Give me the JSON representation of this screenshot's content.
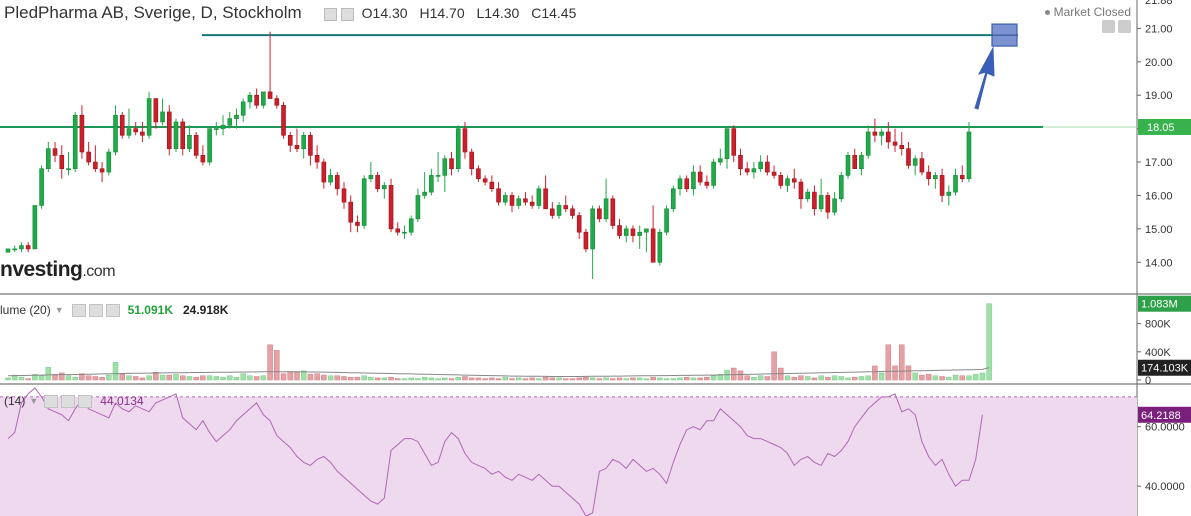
{
  "header": {
    "symbol": "PledPharma AB, Sverige, D, Stockholm",
    "open": "O14.30",
    "high": "H14.70",
    "low": "L14.30",
    "close": "C14.45",
    "market_status": "Market Closed"
  },
  "watermark": {
    "brand": "nvesting",
    "domain": ".com"
  },
  "volume_panel": {
    "label": "lume (20)",
    "value1": "51.091K",
    "value2": "24.918K"
  },
  "rsi_panel": {
    "label": "(14)",
    "value": "44.0134"
  },
  "colors": {
    "up": "#21a94a",
    "down": "#cc1f2b",
    "up_vol": "#9ee0a8",
    "down_vol": "#e5a1a6",
    "level_line": "#1d9656",
    "resistance_line": "#16777a",
    "arrow": "#3b5fb8",
    "rsi_fill": "#efd9ef",
    "rsi_line": "#b067b6",
    "rsi_badge": "#7b1f7c"
  },
  "chart_data": [
    {
      "type": "candlestick",
      "y_ticks": [
        "21.00",
        "20.00",
        "19.00",
        "18.00",
        "17.00",
        "16.00",
        "15.00",
        "14.00"
      ],
      "ylim": [
        13.05,
        21.85
      ],
      "top_partial_label": "21.88",
      "horizontal_lines": [
        {
          "value": 20.8,
          "name": "resistance"
        },
        {
          "value": 18.05,
          "name": "level",
          "label": "18.05"
        }
      ],
      "ohlc": [
        [
          14.3,
          14.4,
          14.3,
          14.4
        ],
        [
          14.4,
          14.5,
          14.3,
          14.4
        ],
        [
          14.4,
          14.6,
          14.3,
          14.5
        ],
        [
          14.5,
          14.6,
          14.3,
          14.4
        ],
        [
          14.4,
          15.7,
          14.4,
          15.7
        ],
        [
          15.7,
          16.9,
          15.6,
          16.8
        ],
        [
          16.8,
          17.6,
          16.7,
          17.4
        ],
        [
          17.4,
          17.6,
          17.0,
          17.2
        ],
        [
          17.2,
          17.5,
          16.5,
          16.8
        ],
        [
          16.8,
          17.3,
          16.6,
          16.8
        ],
        [
          16.8,
          18.5,
          16.7,
          18.4
        ],
        [
          18.4,
          18.7,
          17.1,
          17.3
        ],
        [
          17.3,
          17.6,
          16.9,
          17.0
        ],
        [
          17.0,
          17.5,
          16.7,
          16.8
        ],
        [
          16.8,
          17.0,
          16.4,
          16.7
        ],
        [
          16.7,
          17.4,
          16.6,
          17.3
        ],
        [
          17.3,
          18.7,
          17.2,
          18.4
        ],
        [
          18.4,
          18.5,
          17.7,
          17.8
        ],
        [
          17.8,
          18.6,
          17.7,
          18.0
        ],
        [
          18.0,
          18.2,
          17.8,
          17.9
        ],
        [
          17.9,
          18.2,
          17.6,
          17.8
        ],
        [
          17.8,
          19.1,
          17.7,
          18.9
        ],
        [
          18.9,
          18.9,
          18.0,
          18.2
        ],
        [
          18.2,
          18.9,
          18.1,
          18.5
        ],
        [
          18.5,
          18.7,
          17.2,
          17.4
        ],
        [
          17.4,
          18.3,
          17.3,
          18.2
        ],
        [
          18.2,
          18.3,
          17.2,
          17.4
        ],
        [
          17.4,
          18.1,
          17.3,
          17.8
        ],
        [
          17.8,
          17.9,
          17.1,
          17.2
        ],
        [
          17.2,
          17.5,
          16.9,
          17.0
        ],
        [
          17.0,
          18.0,
          16.9,
          18.0
        ],
        [
          18.0,
          18.2,
          17.8,
          18.0
        ],
        [
          18.0,
          18.4,
          17.8,
          18.1
        ],
        [
          18.1,
          18.5,
          18.0,
          18.3
        ],
        [
          18.3,
          18.6,
          18.0,
          18.4
        ],
        [
          18.4,
          18.9,
          18.2,
          18.8
        ],
        [
          18.8,
          19.1,
          18.6,
          19.0
        ],
        [
          19.0,
          19.2,
          18.6,
          18.7
        ],
        [
          18.7,
          19.1,
          18.6,
          19.1
        ],
        [
          19.1,
          20.9,
          18.9,
          18.9
        ],
        [
          18.9,
          19.0,
          18.6,
          18.7
        ],
        [
          18.7,
          18.8,
          17.7,
          17.8
        ],
        [
          17.8,
          17.9,
          17.3,
          17.5
        ],
        [
          17.5,
          18.0,
          17.3,
          17.4
        ],
        [
          17.4,
          17.9,
          17.1,
          17.8
        ],
        [
          17.8,
          17.9,
          16.9,
          17.2
        ],
        [
          17.2,
          17.5,
          16.8,
          17.0
        ],
        [
          17.0,
          17.1,
          16.2,
          16.4
        ],
        [
          16.4,
          16.8,
          16.3,
          16.6
        ],
        [
          16.6,
          16.7,
          16.0,
          16.2
        ],
        [
          16.2,
          16.4,
          15.6,
          15.8
        ],
        [
          15.8,
          16.0,
          14.9,
          15.2
        ],
        [
          15.2,
          15.4,
          14.9,
          15.1
        ],
        [
          15.1,
          16.6,
          15.0,
          16.5
        ],
        [
          16.5,
          17.0,
          16.4,
          16.6
        ],
        [
          16.6,
          16.7,
          16.1,
          16.2
        ],
        [
          16.2,
          16.4,
          15.9,
          16.3
        ],
        [
          16.3,
          16.5,
          14.9,
          15.0
        ],
        [
          15.0,
          15.2,
          14.8,
          14.9
        ],
        [
          14.9,
          15.1,
          14.7,
          14.9
        ],
        [
          14.9,
          15.4,
          14.8,
          15.3
        ],
        [
          15.3,
          16.2,
          15.2,
          16.0
        ],
        [
          16.0,
          16.7,
          15.9,
          16.1
        ],
        [
          16.1,
          16.8,
          16.0,
          16.6
        ],
        [
          16.6,
          17.3,
          16.4,
          16.6
        ],
        [
          16.6,
          17.2,
          16.1,
          17.1
        ],
        [
          17.1,
          17.3,
          16.6,
          16.8
        ],
        [
          16.8,
          18.1,
          16.7,
          18.0
        ],
        [
          18.0,
          18.2,
          17.1,
          17.3
        ],
        [
          17.3,
          17.4,
          16.6,
          16.8
        ],
        [
          16.8,
          16.9,
          16.4,
          16.5
        ],
        [
          16.5,
          16.6,
          16.3,
          16.4
        ],
        [
          16.4,
          16.6,
          16.1,
          16.2
        ],
        [
          16.2,
          16.4,
          15.7,
          15.8
        ],
        [
          15.8,
          16.1,
          15.7,
          16.0
        ],
        [
          16.0,
          16.1,
          15.5,
          15.7
        ],
        [
          15.7,
          16.0,
          15.6,
          15.9
        ],
        [
          15.9,
          16.1,
          15.7,
          15.8
        ],
        [
          15.8,
          16.0,
          15.6,
          15.7
        ],
        [
          15.7,
          16.3,
          15.6,
          16.2
        ],
        [
          16.2,
          16.6,
          15.7,
          15.6
        ],
        [
          15.6,
          15.8,
          15.3,
          15.4
        ],
        [
          15.4,
          15.8,
          15.3,
          15.7
        ],
        [
          15.7,
          16.0,
          15.5,
          15.6
        ],
        [
          15.6,
          15.7,
          15.3,
          15.4
        ],
        [
          15.4,
          15.5,
          14.7,
          14.9
        ],
        [
          14.9,
          15.0,
          14.3,
          14.4
        ],
        [
          14.4,
          15.7,
          13.5,
          15.6
        ],
        [
          15.6,
          15.7,
          15.2,
          15.3
        ],
        [
          15.3,
          16.5,
          15.2,
          15.9
        ],
        [
          15.9,
          16.0,
          15.0,
          15.1
        ],
        [
          15.1,
          15.3,
          14.7,
          14.8
        ],
        [
          14.8,
          15.1,
          14.6,
          15.0
        ],
        [
          15.0,
          15.1,
          14.6,
          14.8
        ],
        [
          14.8,
          15.1,
          14.4,
          14.9
        ],
        [
          14.9,
          15.0,
          14.3,
          15.0
        ],
        [
          15.0,
          15.7,
          14.0,
          14.0
        ],
        [
          14.0,
          15.0,
          13.9,
          14.9
        ],
        [
          14.9,
          15.7,
          14.8,
          15.6
        ],
        [
          15.6,
          16.3,
          15.5,
          16.2
        ],
        [
          16.2,
          16.6,
          16.0,
          16.5
        ],
        [
          16.5,
          16.6,
          16.1,
          16.2
        ],
        [
          16.2,
          16.9,
          16.0,
          16.7
        ],
        [
          16.7,
          16.9,
          16.3,
          16.4
        ],
        [
          16.4,
          16.6,
          16.2,
          16.3
        ],
        [
          16.3,
          17.1,
          16.2,
          17.0
        ],
        [
          17.0,
          17.4,
          16.9,
          17.1
        ],
        [
          17.1,
          18.0,
          16.8,
          18.0
        ],
        [
          18.0,
          18.1,
          17.0,
          17.2
        ],
        [
          17.2,
          17.4,
          16.6,
          16.8
        ],
        [
          16.8,
          17.0,
          16.6,
          16.7
        ],
        [
          16.7,
          17.0,
          16.5,
          16.8
        ],
        [
          16.8,
          17.2,
          16.7,
          17.0
        ],
        [
          17.0,
          17.2,
          16.6,
          16.7
        ],
        [
          16.7,
          16.9,
          16.5,
          16.6
        ],
        [
          16.6,
          16.7,
          16.2,
          16.3
        ],
        [
          16.3,
          16.6,
          16.1,
          16.5
        ],
        [
          16.5,
          16.8,
          16.2,
          16.4
        ],
        [
          16.4,
          16.5,
          15.6,
          15.9
        ],
        [
          15.9,
          16.2,
          15.8,
          16.1
        ],
        [
          16.1,
          16.3,
          15.4,
          15.6
        ],
        [
          15.6,
          16.5,
          15.5,
          16.0
        ],
        [
          16.0,
          16.1,
          15.3,
          15.5
        ],
        [
          15.5,
          16.1,
          15.4,
          15.9
        ],
        [
          15.9,
          16.7,
          15.8,
          16.6
        ],
        [
          16.6,
          17.3,
          16.5,
          17.2
        ],
        [
          17.2,
          17.4,
          16.9,
          16.8
        ],
        [
          16.8,
          17.3,
          16.6,
          17.2
        ],
        [
          17.2,
          18.1,
          17.1,
          17.9
        ],
        [
          17.9,
          18.3,
          17.6,
          17.8
        ],
        [
          17.8,
          18.0,
          17.5,
          17.9
        ],
        [
          17.9,
          18.2,
          17.4,
          17.6
        ],
        [
          17.6,
          18.0,
          17.3,
          17.5
        ],
        [
          17.5,
          17.9,
          17.2,
          17.4
        ],
        [
          17.4,
          17.6,
          16.8,
          16.9
        ],
        [
          16.9,
          17.2,
          16.6,
          17.1
        ],
        [
          17.1,
          17.3,
          16.6,
          16.7
        ],
        [
          16.7,
          16.9,
          16.3,
          16.5
        ],
        [
          16.5,
          16.7,
          16.2,
          16.6
        ],
        [
          16.6,
          16.8,
          15.8,
          16.0
        ],
        [
          16.0,
          16.3,
          15.7,
          16.1
        ],
        [
          16.1,
          16.8,
          16.0,
          16.6
        ],
        [
          16.6,
          16.9,
          16.4,
          16.5
        ],
        [
          16.5,
          18.2,
          16.4,
          17.9
        ]
      ]
    },
    {
      "type": "bar",
      "name": "volume",
      "y_ticks": [
        "800K",
        "400K",
        "0"
      ],
      "ylim": [
        0,
        1150
      ],
      "units": "K",
      "current_label": "1.083M",
      "ma_label": "174.103K",
      "values": [
        30,
        70,
        40,
        20,
        80,
        60,
        180,
        80,
        100,
        60,
        40,
        90,
        60,
        50,
        40,
        70,
        250,
        80,
        60,
        50,
        30,
        60,
        110,
        70,
        70,
        80,
        60,
        50,
        40,
        60,
        60,
        50,
        40,
        60,
        40,
        90,
        60,
        50,
        60,
        500,
        420,
        90,
        120,
        110,
        130,
        80,
        90,
        70,
        60,
        60,
        50,
        40,
        40,
        60,
        40,
        30,
        30,
        40,
        20,
        20,
        30,
        20,
        40,
        30,
        20,
        30,
        20,
        40,
        50,
        30,
        30,
        20,
        30,
        20,
        40,
        20,
        30,
        20,
        30,
        20,
        40,
        30,
        30,
        20,
        20,
        30,
        40,
        30,
        20,
        30,
        20,
        30,
        20,
        30,
        30,
        20,
        40,
        30,
        20,
        20,
        30,
        40,
        30,
        30,
        40,
        60,
        80,
        140,
        170,
        130,
        60,
        40,
        60,
        50,
        400,
        170,
        60,
        40,
        60,
        50,
        30,
        60,
        40,
        60,
        50,
        30,
        40,
        50,
        60,
        200,
        100,
        500,
        200,
        500,
        200,
        100,
        70,
        80,
        60,
        50,
        40,
        70,
        60,
        60,
        80,
        100,
        1083
      ],
      "ma": [
        60,
        62,
        64,
        66,
        68,
        70,
        72,
        74,
        76,
        77,
        78,
        80,
        82,
        84,
        86,
        88,
        90,
        92,
        94,
        95,
        96,
        98,
        100,
        101,
        102,
        103,
        104,
        105,
        106,
        107,
        108,
        109,
        110,
        111,
        112,
        113,
        114,
        115,
        116,
        117,
        118,
        118,
        117,
        116,
        115,
        114,
        113,
        112,
        110,
        108,
        106,
        104,
        102,
        100,
        98,
        96,
        94,
        92,
        90,
        88,
        86,
        84,
        82,
        80,
        78,
        76,
        74,
        72,
        70,
        68,
        66,
        64,
        62,
        60,
        58,
        56,
        55,
        54,
        53,
        52,
        51,
        50,
        50,
        50,
        50,
        50,
        51,
        52,
        53,
        54,
        55,
        56,
        57,
        58,
        59,
        60,
        61,
        62,
        63,
        64,
        65,
        66,
        67,
        68,
        69,
        70,
        72,
        74,
        76,
        78,
        80,
        82,
        84,
        86,
        88,
        90,
        92,
        94,
        96,
        98,
        100,
        102,
        104,
        106,
        108,
        110,
        112,
        114,
        116,
        118,
        120,
        122,
        124,
        126,
        128,
        130,
        132,
        134,
        136,
        138,
        140,
        142,
        144,
        146,
        148,
        150,
        174
      ]
    },
    {
      "type": "line",
      "name": "rsi",
      "y_ticks": [
        "60.0000",
        "40.0000"
      ],
      "ylim": [
        30,
        74
      ],
      "current_label": "64.2188",
      "overbought": 70,
      "values": [
        56,
        58,
        68,
        71,
        73,
        70,
        66,
        65,
        64,
        62,
        66,
        69,
        66,
        65,
        64,
        63,
        68,
        66,
        65,
        67,
        66,
        65,
        68,
        69,
        70,
        71,
        63,
        61,
        59,
        62,
        58,
        55,
        57,
        59,
        62,
        64,
        66,
        68,
        64,
        62,
        57,
        55,
        53,
        50,
        48,
        47,
        49,
        50,
        48,
        45,
        43,
        41,
        39,
        37,
        35,
        34,
        36,
        52,
        54,
        56,
        56,
        55,
        51,
        47,
        48,
        55,
        58,
        56,
        51,
        48,
        47,
        46,
        44,
        45,
        43,
        42,
        44,
        43,
        42,
        44,
        42,
        40,
        40,
        38,
        36,
        34,
        30,
        31,
        45,
        46,
        49,
        48,
        46,
        49,
        47,
        45,
        46,
        44,
        41,
        48,
        54,
        59,
        60,
        59,
        62,
        62,
        66,
        64,
        62,
        60,
        57,
        56,
        56,
        55,
        54,
        53,
        51,
        47,
        49,
        50,
        48,
        47,
        51,
        50,
        52,
        55,
        60,
        63,
        66,
        68,
        70,
        70,
        71,
        65,
        66,
        64,
        55,
        50,
        47,
        49,
        44,
        40,
        42,
        42,
        49,
        64
      ]
    }
  ]
}
